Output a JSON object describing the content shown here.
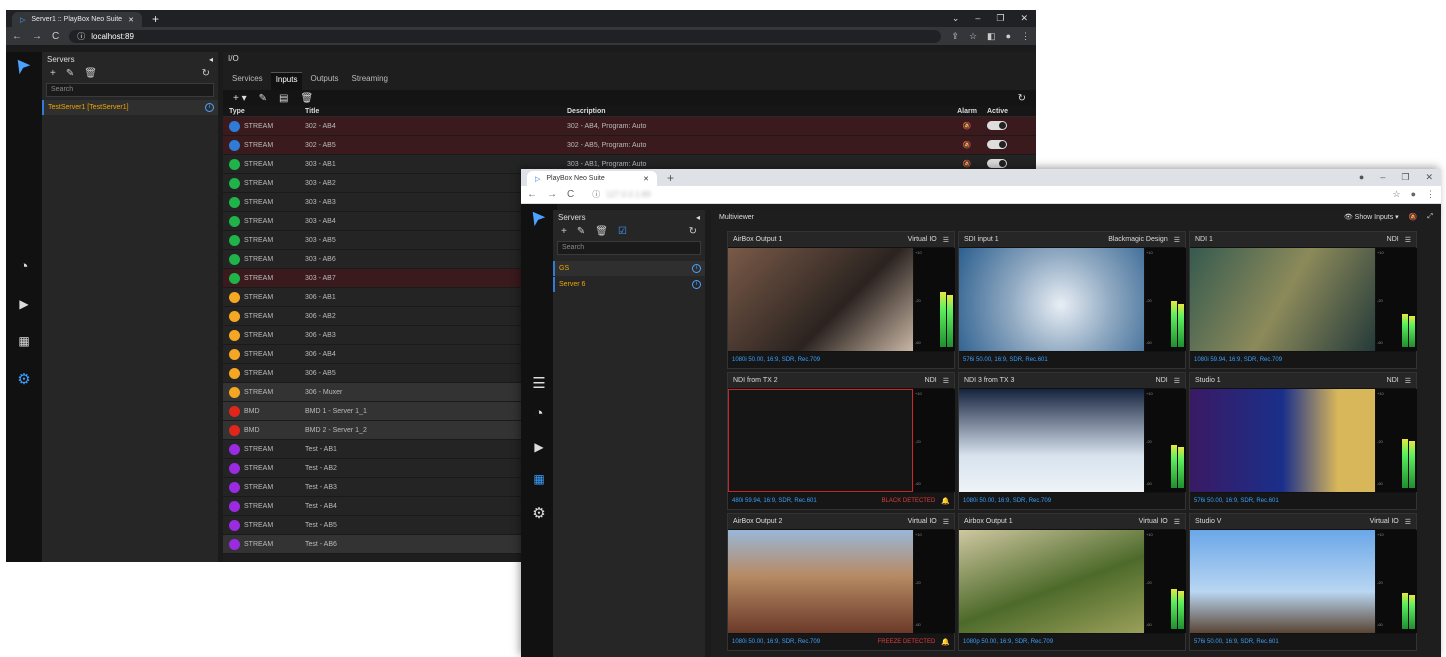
{
  "w1": {
    "tab_title": "Server1 :: PlayBox Neo Suite",
    "url": "localhost:89",
    "servers": {
      "title": "Servers",
      "search_placeholder": "Search",
      "item": "TestServer1 [TestServer1]"
    },
    "io": {
      "title": "I/O",
      "tabs": [
        "Services",
        "Inputs",
        "Outputs",
        "Streaming"
      ],
      "columns": [
        "Type",
        "Title",
        "Description",
        "Alarm",
        "Active"
      ],
      "rows": [
        {
          "type": "STREAM",
          "title": "302 - AB4",
          "desc": "302 - AB4, Program: Auto",
          "color": "#2f7bd8",
          "state": "err"
        },
        {
          "type": "STREAM",
          "title": "302 - AB5",
          "desc": "302 - AB5, Program: Auto",
          "color": "#2f7bd8",
          "state": "err"
        },
        {
          "type": "STREAM",
          "title": "303 - AB1",
          "desc": "303 - AB1, Program: Auto",
          "color": "#1fb34a",
          "state": ""
        },
        {
          "type": "STREAM",
          "title": "303 - AB2",
          "desc": "",
          "color": "#1fb34a",
          "state": ""
        },
        {
          "type": "STREAM",
          "title": "303 - AB3",
          "desc": "",
          "color": "#1fb34a",
          "state": ""
        },
        {
          "type": "STREAM",
          "title": "303 - AB4",
          "desc": "",
          "color": "#1fb34a",
          "state": ""
        },
        {
          "type": "STREAM",
          "title": "303 - AB5",
          "desc": "",
          "color": "#1fb34a",
          "state": ""
        },
        {
          "type": "STREAM",
          "title": "303 - AB6",
          "desc": "",
          "color": "#1fb34a",
          "state": ""
        },
        {
          "type": "STREAM",
          "title": "303 - AB7",
          "desc": "",
          "color": "#1fb34a",
          "state": "err"
        },
        {
          "type": "STREAM",
          "title": "306 - AB1",
          "desc": "",
          "color": "#f5a623",
          "state": ""
        },
        {
          "type": "STREAM",
          "title": "306 - AB2",
          "desc": "",
          "color": "#f5a623",
          "state": ""
        },
        {
          "type": "STREAM",
          "title": "306 - AB3",
          "desc": "",
          "color": "#f5a623",
          "state": ""
        },
        {
          "type": "STREAM",
          "title": "306 - AB4",
          "desc": "",
          "color": "#f5a623",
          "state": ""
        },
        {
          "type": "STREAM",
          "title": "306 - AB5",
          "desc": "",
          "color": "#f5a623",
          "state": ""
        },
        {
          "type": "STREAM",
          "title": "306 - Muxer",
          "desc": "",
          "color": "#f5a623",
          "state": "sel"
        },
        {
          "type": "BMD",
          "title": "BMD 1 - Server 1_1",
          "desc": "",
          "color": "#e0261b",
          "state": "sel"
        },
        {
          "type": "BMD",
          "title": "BMD 2 - Server 1_2",
          "desc": "",
          "color": "#e0261b",
          "state": "sel"
        },
        {
          "type": "STREAM",
          "title": "Test - AB1",
          "desc": "",
          "color": "#9a2be0",
          "state": ""
        },
        {
          "type": "STREAM",
          "title": "Test - AB2",
          "desc": "",
          "color": "#9a2be0",
          "state": ""
        },
        {
          "type": "STREAM",
          "title": "Test - AB3",
          "desc": "",
          "color": "#9a2be0",
          "state": ""
        },
        {
          "type": "STREAM",
          "title": "Test - AB4",
          "desc": "",
          "color": "#9a2be0",
          "state": ""
        },
        {
          "type": "STREAM",
          "title": "Test - AB5",
          "desc": "",
          "color": "#9a2be0",
          "state": ""
        },
        {
          "type": "STREAM",
          "title": "Test - AB6",
          "desc": "",
          "color": "#9a2be0",
          "state": "sel"
        }
      ]
    }
  },
  "w2": {
    "tab_title": "PlayBox Neo Suite",
    "url": "127.0.0.1:89",
    "servers": {
      "title": "Servers",
      "search_placeholder": "Search",
      "items": [
        "GS",
        "Server 6"
      ]
    },
    "mv": {
      "title": "Multiviewer",
      "show_inputs": "Show Inputs",
      "tiles": [
        {
          "name": "AirBox Output 1",
          "src": "Virtual IO",
          "fmt": "1080i 50.00, 16:9, SDR, Rec.709",
          "alert": "",
          "bg": "linear-gradient(135deg,#7a5a48,#2b2320 60%,#c9b6a4)",
          "level": 0.58
        },
        {
          "name": "SDI input 1",
          "src": "Blackmagic Design",
          "fmt": "576i 50.00, 16:9, SDR, Rec.601",
          "alert": "",
          "bg": "radial-gradient(circle at 55% 55%,#e8eef5,#8da7c0 45%,#2c5f8f)",
          "level": 0.48
        },
        {
          "name": "NDI 1",
          "src": "NDI",
          "fmt": "1080i 59.94, 16:9, SDR, Rec.709",
          "alert": "",
          "bg": "linear-gradient(120deg,#355a4f,#8c8a5a 50%,#243a3a)",
          "level": 0.35
        },
        {
          "name": "NDI from TX 2",
          "src": "NDI",
          "fmt": "480i 59.94, 16:9, SDR, Rec.601",
          "alert": "BLACK DETECTED",
          "bg": "#151515",
          "level": 0.0
        },
        {
          "name": "NDI 3 from TX 3",
          "src": "NDI",
          "fmt": "1080i 50.00, 16:9, SDR, Rec.709",
          "alert": "",
          "bg": "linear-gradient(180deg,#15233f,#d8e3ee 65%,#eef3f7)",
          "level": 0.45
        },
        {
          "name": "Studio 1",
          "src": "NDI",
          "fmt": "576i 50.00, 16:9, SDR, Rec.601",
          "alert": "",
          "bg": "linear-gradient(90deg,#3a1a64,#1a2f8a 50%,#d8b75a 80%)",
          "level": 0.52
        },
        {
          "name": "AirBox Output 2",
          "src": "Virtual IO",
          "fmt": "1080i 50.00, 16:9, SDR, Rec.709",
          "alert": "FREEZE DETECTED",
          "bg": "linear-gradient(180deg,#9ab7d8,#b68a62 45%,#6b3a2a)",
          "level": 0.0
        },
        {
          "name": "Airbox Output 1",
          "src": "Virtual IO",
          "fmt": "1080p 50.00, 16:9, SDR, Rec.709",
          "alert": "",
          "bg": "linear-gradient(160deg,#cfc7a0,#4d6a2a 55%,#9aa05a)",
          "level": 0.42
        },
        {
          "name": "Studio V",
          "src": "Virtual IO",
          "fmt": "576i 50.00, 16:9, SDR, Rec.601",
          "alert": "",
          "bg": "linear-gradient(180deg,#6aa7e8,#b9d6f2 60%,#5a4535)",
          "level": 0.38
        }
      ]
    }
  }
}
